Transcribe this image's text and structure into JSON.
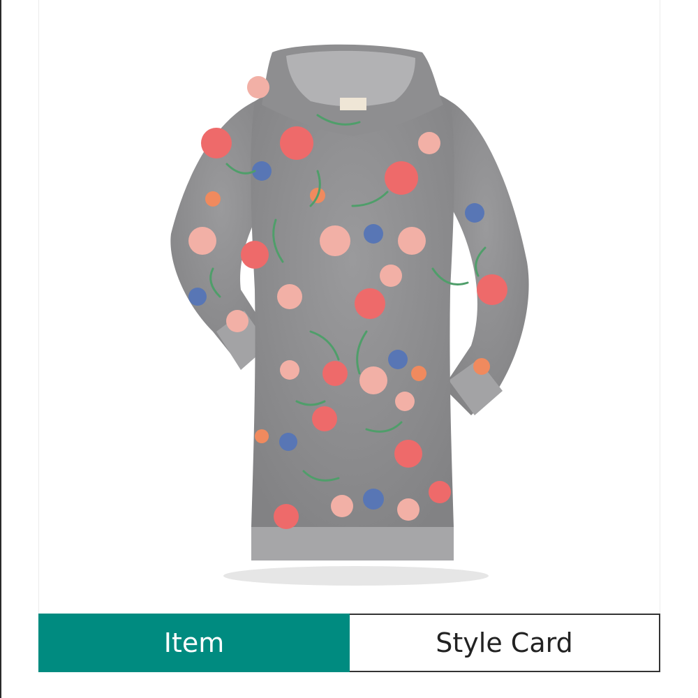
{
  "product": {
    "image_icon": "floral-hooded-sweatshirt-dress",
    "colors": {
      "fabric": "#8d8d8f",
      "fabric_light": "#a0a0a2",
      "flower_coral": "#ee6a6a",
      "flower_pink": "#f2b0a6",
      "flower_blue": "#5876b5",
      "leaf_green": "#4f9e6a"
    }
  },
  "tabs": [
    {
      "label": "Item",
      "active": true
    },
    {
      "label": "Style Card",
      "active": false
    }
  ],
  "colors": {
    "accent": "#008b80",
    "text_dark": "#222222",
    "border": "#333333"
  }
}
